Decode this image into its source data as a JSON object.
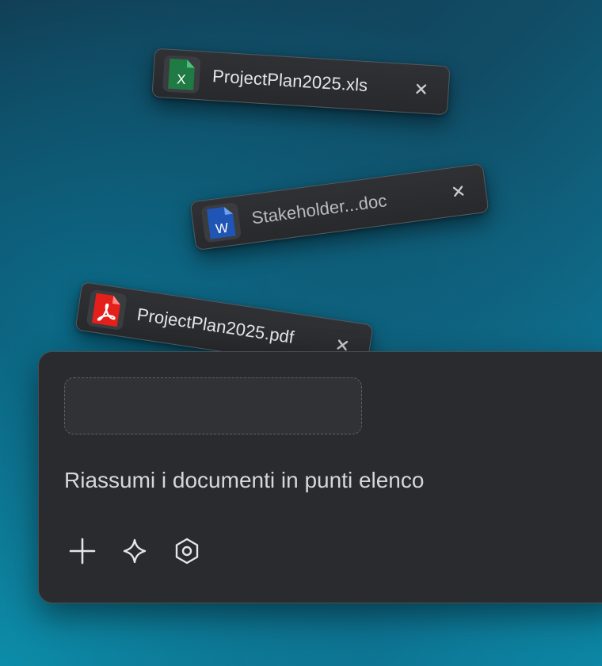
{
  "attachments": [
    {
      "name": "ProjectPlan2025.xls",
      "icon": "excel-file-icon",
      "icon_letter": "X",
      "color": "#1f7a43"
    },
    {
      "name": "Stakeholder...doc",
      "icon": "word-file-icon",
      "icon_letter": "W",
      "color": "#1f55b4"
    },
    {
      "name": "ProjectPlan2025.pdf",
      "icon": "pdf-file-icon",
      "icon_letter": "",
      "color": "#e5201b"
    }
  ],
  "composer": {
    "prompt": "Riassumi i documenti in punti elenco",
    "tools": [
      "plus-icon",
      "sparkle-icon",
      "settings-hex-icon"
    ]
  },
  "colors": {
    "panel": "#2a2b2e",
    "chip": "#2f3134",
    "text": "#d6d7d9"
  }
}
